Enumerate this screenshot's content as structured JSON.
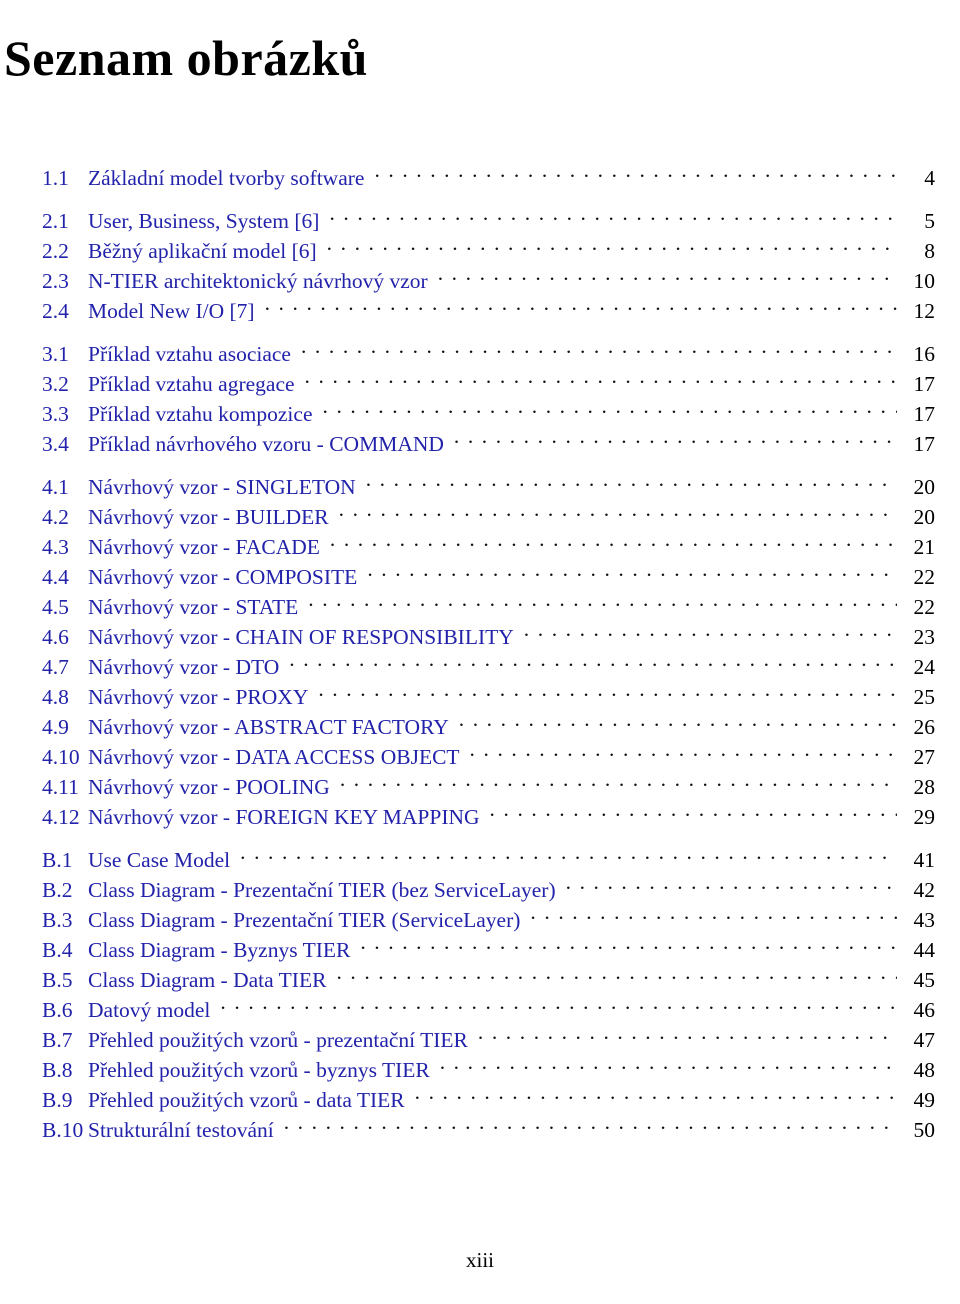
{
  "page": {
    "title": "Seznam obrázků",
    "footer_page_number": "xiii",
    "colors": {
      "link": "#2222aa",
      "text": "#000000",
      "background": "#ffffff"
    }
  },
  "list_of_figures": {
    "groups": [
      {
        "group_id": "chapter-1",
        "entries": [
          {
            "number": "1.1",
            "label": "Základní model tvorby software",
            "page": "4"
          }
        ]
      },
      {
        "group_id": "chapter-2",
        "entries": [
          {
            "number": "2.1",
            "label": "User, Business, System [6]",
            "page": "5"
          },
          {
            "number": "2.2",
            "label": "Běžný aplikační model [6]",
            "page": "8"
          },
          {
            "number": "2.3",
            "label": "N-TIER architektonický návrhový vzor",
            "page": "10"
          },
          {
            "number": "2.4",
            "label": "Model New I/O [7]",
            "page": "12"
          }
        ]
      },
      {
        "group_id": "chapter-3",
        "entries": [
          {
            "number": "3.1",
            "label": "Příklad vztahu asociace",
            "page": "16"
          },
          {
            "number": "3.2",
            "label": "Příklad vztahu agregace",
            "page": "17"
          },
          {
            "number": "3.3",
            "label": "Příklad vztahu kompozice",
            "page": "17"
          },
          {
            "number": "3.4",
            "label": "Příklad návrhového vzoru - COMMAND",
            "page": "17"
          }
        ]
      },
      {
        "group_id": "chapter-4",
        "entries": [
          {
            "number": "4.1",
            "label": "Návrhový vzor - SINGLETON",
            "page": "20"
          },
          {
            "number": "4.2",
            "label": "Návrhový vzor - BUILDER",
            "page": "20"
          },
          {
            "number": "4.3",
            "label": "Návrhový vzor - FACADE",
            "page": "21"
          },
          {
            "number": "4.4",
            "label": "Návrhový vzor - COMPOSITE",
            "page": "22"
          },
          {
            "number": "4.5",
            "label": "Návrhový vzor - STATE",
            "page": "22"
          },
          {
            "number": "4.6",
            "label": "Návrhový vzor - CHAIN OF RESPONSIBILITY",
            "page": "23"
          },
          {
            "number": "4.7",
            "label": "Návrhový vzor - DTO",
            "page": "24"
          },
          {
            "number": "4.8",
            "label": "Návrhový vzor - PROXY",
            "page": "25"
          },
          {
            "number": "4.9",
            "label": "Návrhový vzor - ABSTRACT FACTORY",
            "page": "26"
          },
          {
            "number": "4.10",
            "label": "Návrhový vzor - DATA ACCESS OBJECT",
            "page": "27"
          },
          {
            "number": "4.11",
            "label": "Návrhový vzor - POOLING",
            "page": "28"
          },
          {
            "number": "4.12",
            "label": "Návrhový vzor - FOREIGN KEY MAPPING",
            "page": "29"
          }
        ]
      },
      {
        "group_id": "appendix-b",
        "entries": [
          {
            "number": "B.1",
            "label": "Use Case Model",
            "page": "41"
          },
          {
            "number": "B.2",
            "label": "Class Diagram - Prezentační TIER (bez ServiceLayer)",
            "page": "42"
          },
          {
            "number": "B.3",
            "label": "Class Diagram - Prezentační TIER (ServiceLayer)",
            "page": "43"
          },
          {
            "number": "B.4",
            "label": "Class Diagram - Byznys TIER",
            "page": "44"
          },
          {
            "number": "B.5",
            "label": "Class Diagram - Data TIER",
            "page": "45"
          },
          {
            "number": "B.6",
            "label": "Datový model",
            "page": "46"
          },
          {
            "number": "B.7",
            "label": "Přehled použitých vzorů - prezentační TIER",
            "page": "47"
          },
          {
            "number": "B.8",
            "label": "Přehled použitých vzorů - byznys TIER",
            "page": "48"
          },
          {
            "number": "B.9",
            "label": "Přehled použitých vzorů - data TIER",
            "page": "49"
          },
          {
            "number": "B.10",
            "label": "Strukturální testování",
            "page": "50"
          }
        ]
      }
    ]
  }
}
